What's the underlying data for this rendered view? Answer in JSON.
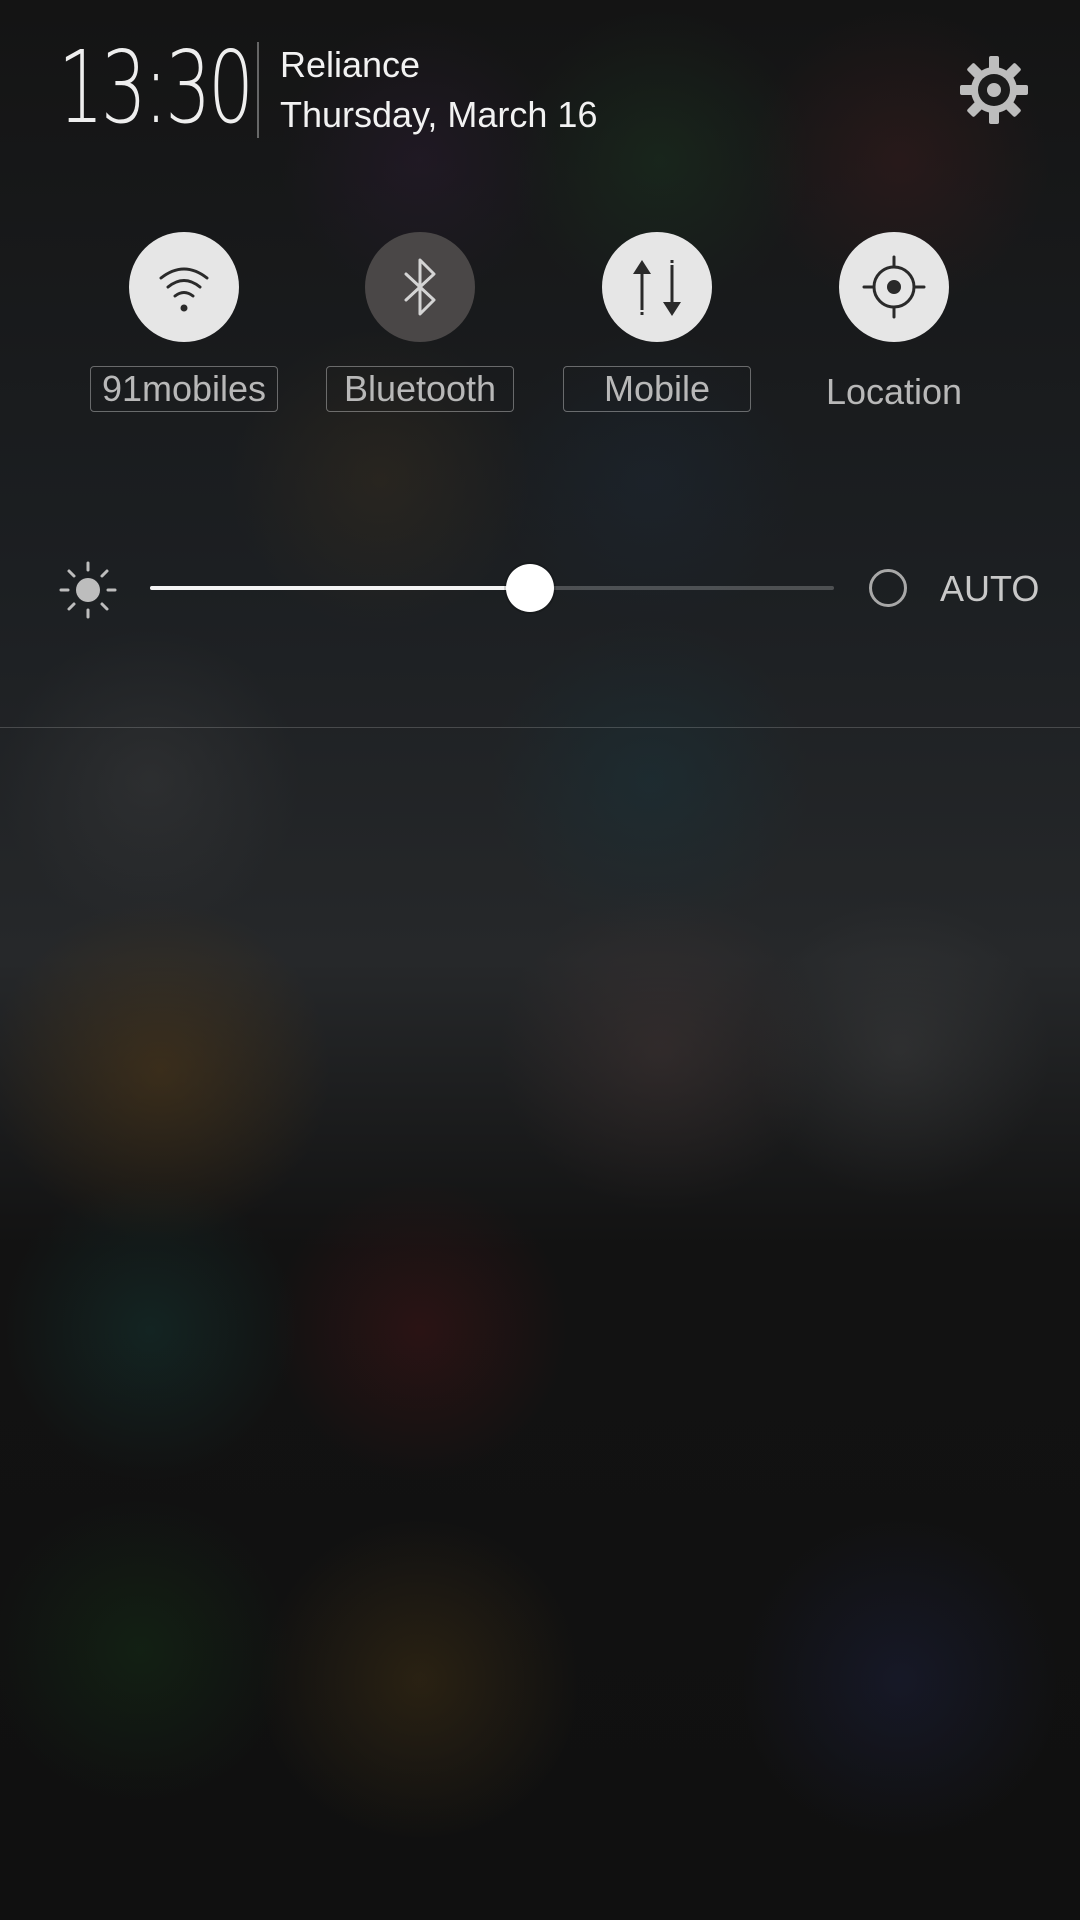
{
  "header": {
    "time": "13:30",
    "carrier": "Reliance",
    "date": "Thursday, March 16",
    "settings_icon": "gear-icon"
  },
  "toggles": [
    {
      "label": "91mobiles",
      "icon": "wifi-icon",
      "state": "on"
    },
    {
      "label": "Bluetooth",
      "icon": "bluetooth-icon",
      "state": "off"
    },
    {
      "label": "Mobile",
      "icon": "mobile-data-icon",
      "state": "on"
    },
    {
      "label": "Location",
      "icon": "location-icon",
      "state": "on"
    }
  ],
  "brightness": {
    "icon": "brightness-sun-icon",
    "level": 0.555,
    "auto_label": "AUTO",
    "auto_enabled": false
  },
  "colors": {
    "toggle_on": "#e6e6e6",
    "toggle_off": "#4a4747",
    "text_primary": "#f2f2f2",
    "text_secondary": "#b8b8b8"
  }
}
